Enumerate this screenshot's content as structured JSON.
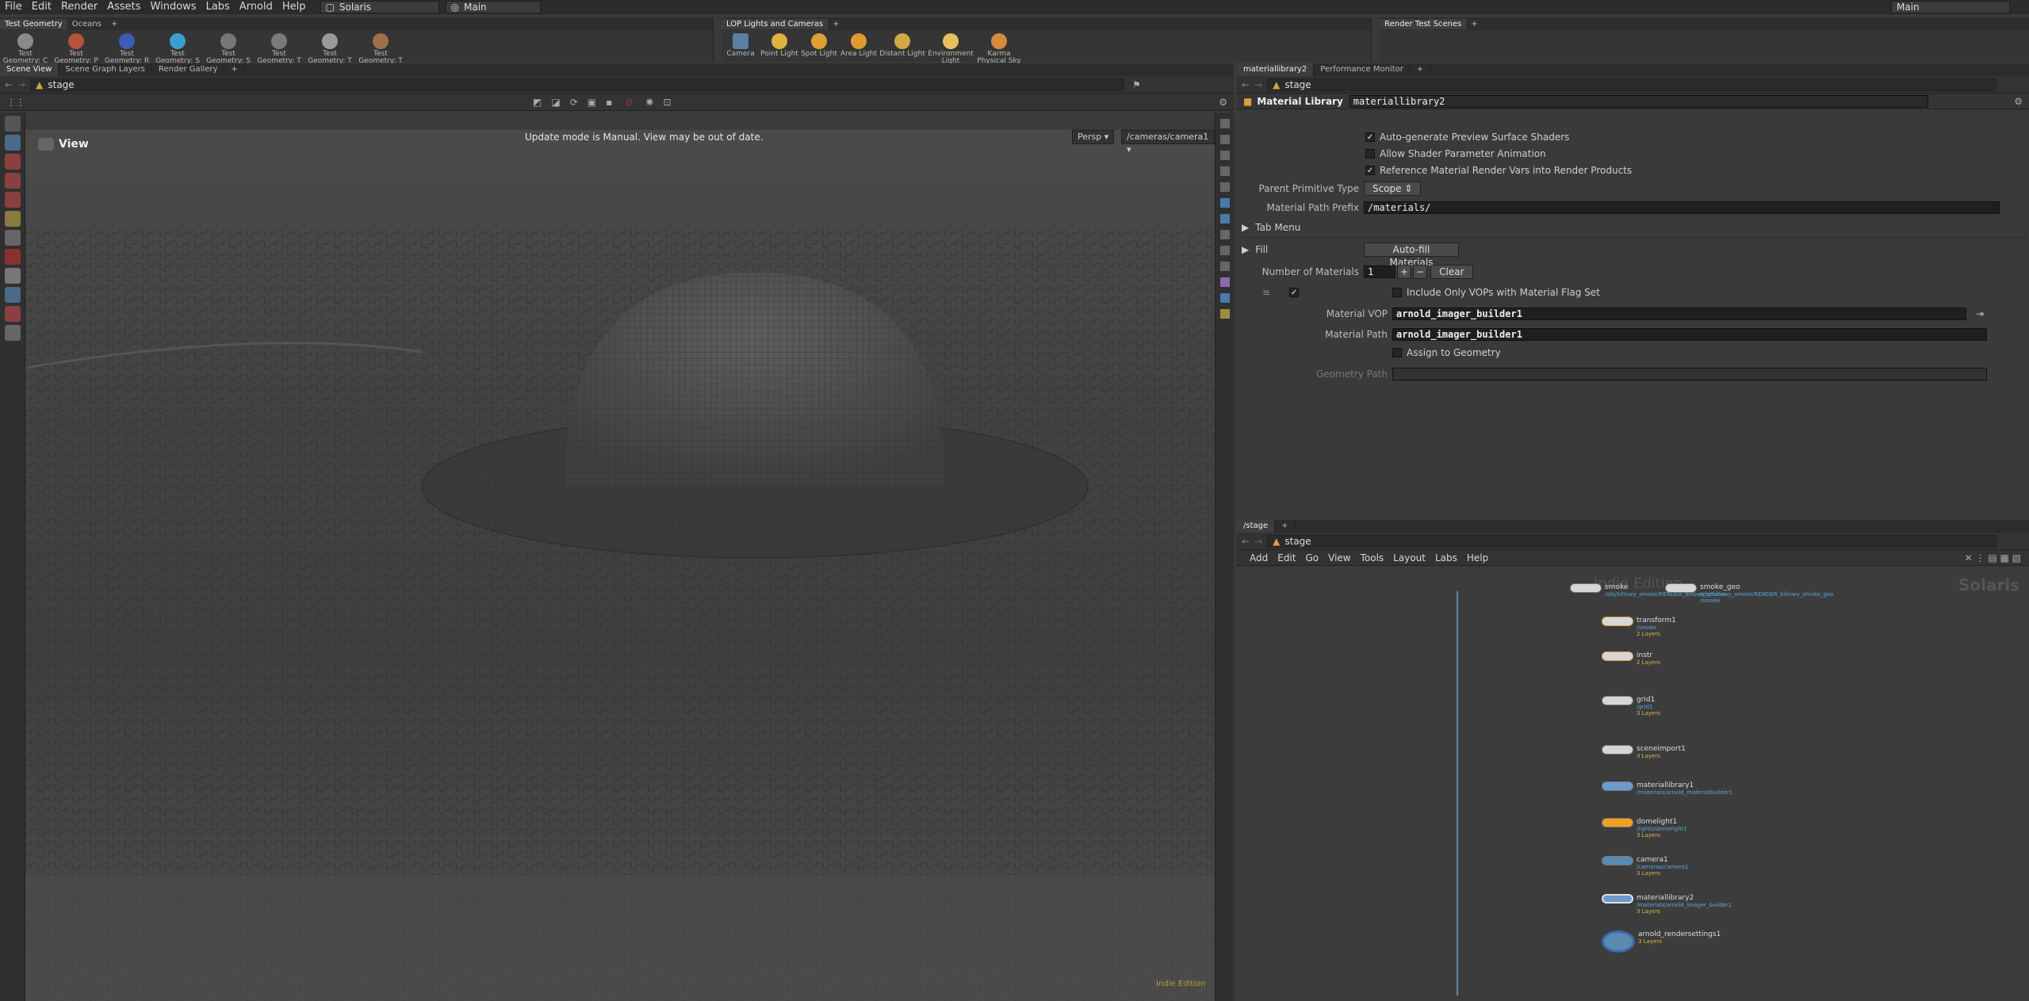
{
  "menubar": {
    "items": [
      "File",
      "Edit",
      "Render",
      "Assets",
      "Windows",
      "Labs",
      "Arnold",
      "Help"
    ],
    "desktop": "Solaris",
    "context": "Main",
    "right_context": "Main"
  },
  "shelf_left": {
    "tabs": [
      "Test Geometry",
      "Oceans"
    ],
    "tools": [
      "Test Geometry: C",
      "Test Geometry: P",
      "Test Geometry: R",
      "Test Geometry: S",
      "Test Geometry: S",
      "Test Geometry: T",
      "Test Geometry: T",
      "Test Geometry: T"
    ]
  },
  "shelf_mid": {
    "tabs": [
      "LOP Lights and Cameras"
    ],
    "tools": [
      "Camera",
      "Point Light",
      "Spot Light",
      "Area Light",
      "Distant Light",
      "Environment Light",
      "Karma Physical Sky"
    ]
  },
  "shelf_right": {
    "tabs": [
      "Render Test Scenes"
    ]
  },
  "viewer": {
    "tabs": [
      "Scene View",
      "Scene Graph Layers",
      "Render Gallery"
    ],
    "path": "stage",
    "title": "View",
    "notice": "Update mode is Manual. View may be out of date.",
    "persp": "Persp",
    "camera": "/cameras/camera1",
    "edition": "Indie Edition"
  },
  "params": {
    "tabs": [
      "materiallibrary2",
      "Performance Monitor"
    ],
    "path": "stage",
    "node_type": "Material Library",
    "node_name": "materiallibrary2",
    "auto_preview": "Auto-generate Preview Surface Shaders",
    "allow_anim": "Allow Shader Parameter Animation",
    "ref_render_vars": "Reference Material Render Vars into Render Products",
    "parent_prim_label": "Parent Primitive Type",
    "parent_prim_value": "Scope",
    "mat_prefix_label": "Material Path Prefix",
    "mat_prefix_value": "/materials/",
    "tab_menu": "Tab Menu",
    "fill": "Fill",
    "autofill": "Auto-fill Materials",
    "num_mats_label": "Number of Materials",
    "num_mats_value": "1",
    "plus": "+",
    "minus": "−",
    "clear": "Clear",
    "include_only": "Include Only VOPs with Material Flag Set",
    "mat_vop_label": "Material VOP",
    "mat_vop_value": "arnold_imager_builder1",
    "mat_path_label": "Material Path",
    "mat_path_value": "arnold_imager_builder1",
    "assign_geo": "Assign to Geometry",
    "geo_path_label": "Geometry Path"
  },
  "network": {
    "tabs": [
      "/stage"
    ],
    "path": "stage",
    "menu": [
      "Add",
      "Edit",
      "Go",
      "View",
      "Tools",
      "Layout",
      "Labs",
      "Help"
    ],
    "watermark": "Indie Edition",
    "context_label": "Solaris",
    "nodes": [
      {
        "name": "smoke",
        "sub": "/obj/billowy_smoke/RENDER_billowy_smoke",
        "flags": ""
      },
      {
        "name": "smoke_geo",
        "sub": "/obj/billowy_smoke/RENDER_billowy_smoke_geo /smoke",
        "flags": ""
      },
      {
        "name": "transform1",
        "sub": "/smoke",
        "flags": "2 Layers"
      },
      {
        "name": "instr",
        "sub": "",
        "flags": "2 Layers"
      },
      {
        "name": "grid1",
        "sub": "/grid1",
        "flags": "3 Layers"
      },
      {
        "name": "sceneimport1",
        "sub": "",
        "flags": "3 Layers"
      },
      {
        "name": "materiallibrary1",
        "sub": "/materials/arnold_materialbuilder1",
        "flags": ""
      },
      {
        "name": "domelight1",
        "sub": "/lights/domelight1",
        "flags": "3 Layers"
      },
      {
        "name": "camera1",
        "sub": "/cameras/camera1",
        "flags": "3 Layers"
      },
      {
        "name": "materiallibrary2",
        "sub": "/materials/arnold_imager_builder1",
        "flags": "3 Layers"
      },
      {
        "name": "arnold_rendersettings1",
        "sub": "",
        "flags": "3 Layers"
      }
    ]
  }
}
